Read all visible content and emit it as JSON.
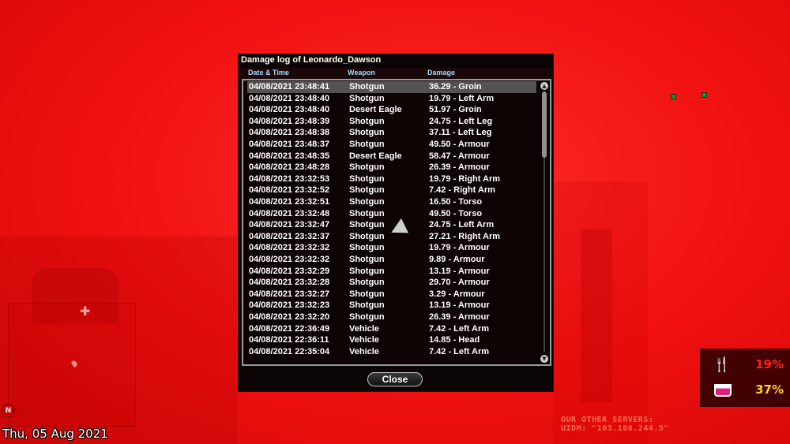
{
  "dialog": {
    "title": "Damage log of Leonardo_Dawson",
    "columns": {
      "date": "Date & Time",
      "weapon": "Weapon",
      "damage": "Damage"
    },
    "rows": [
      {
        "date": "04/08/2021 23:48:41",
        "weapon": "Shotgun",
        "damage": "36.29 - Groin"
      },
      {
        "date": "04/08/2021 23:48:40",
        "weapon": "Shotgun",
        "damage": "19.79 - Left Arm"
      },
      {
        "date": "04/08/2021 23:48:40",
        "weapon": "Desert Eagle",
        "damage": "51.97 - Groin"
      },
      {
        "date": "04/08/2021 23:48:39",
        "weapon": "Shotgun",
        "damage": "24.75 - Left Leg"
      },
      {
        "date": "04/08/2021 23:48:38",
        "weapon": "Shotgun",
        "damage": "37.11 - Left Leg"
      },
      {
        "date": "04/08/2021 23:48:37",
        "weapon": "Shotgun",
        "damage": "49.50 - Armour"
      },
      {
        "date": "04/08/2021 23:48:35",
        "weapon": "Desert Eagle",
        "damage": "58.47 - Armour"
      },
      {
        "date": "04/08/2021 23:48:28",
        "weapon": "Shotgun",
        "damage": "26.39 - Armour"
      },
      {
        "date": "04/08/2021 23:32:53",
        "weapon": "Shotgun",
        "damage": "19.79 - Right Arm"
      },
      {
        "date": "04/08/2021 23:32:52",
        "weapon": "Shotgun",
        "damage": "7.42 - Right Arm"
      },
      {
        "date": "04/08/2021 23:32:51",
        "weapon": "Shotgun",
        "damage": "16.50 - Torso"
      },
      {
        "date": "04/08/2021 23:32:48",
        "weapon": "Shotgun",
        "damage": "49.50 - Torso"
      },
      {
        "date": "04/08/2021 23:32:47",
        "weapon": "Shotgun",
        "damage": "24.75 - Left Arm"
      },
      {
        "date": "04/08/2021 23:32:37",
        "weapon": "Shotgun",
        "damage": "27.21 - Right Arm"
      },
      {
        "date": "04/08/2021 23:32:32",
        "weapon": "Shotgun",
        "damage": "19.79 - Armour"
      },
      {
        "date": "04/08/2021 23:32:32",
        "weapon": "Shotgun",
        "damage": "9.89 - Armour"
      },
      {
        "date": "04/08/2021 23:32:29",
        "weapon": "Shotgun",
        "damage": "13.19 - Armour"
      },
      {
        "date": "04/08/2021 23:32:28",
        "weapon": "Shotgun",
        "damage": "29.70 - Armour"
      },
      {
        "date": "04/08/2021 23:32:27",
        "weapon": "Shotgun",
        "damage": "3.29 - Armour"
      },
      {
        "date": "04/08/2021 23:32:23",
        "weapon": "Shotgun",
        "damage": "13.19 - Armour"
      },
      {
        "date": "04/08/2021 23:32:20",
        "weapon": "Shotgun",
        "damage": "26.39 - Armour"
      },
      {
        "date": "04/08/2021 22:36:49",
        "weapon": "Vehicle",
        "damage": "7.42 - Left Arm"
      },
      {
        "date": "04/08/2021 22:36:11",
        "weapon": "Vehicle",
        "damage": "14.85 - Head"
      },
      {
        "date": "04/08/2021 22:35:04",
        "weapon": "Vehicle",
        "damage": "7.42 - Left Arm"
      }
    ],
    "close_label": "Close"
  },
  "hud": {
    "date_text": "Thu, 05 Aug 2021",
    "compass_label": "N",
    "hunger_value": "19%",
    "thirst_value": "37%",
    "hunger_icon": "fork-knife-icon",
    "thirst_icon": "cup-icon",
    "server_lines": [
      "OUR OTHER SERVERS:",
      "UIDM: \"103.166.244.5\""
    ]
  },
  "colors": {
    "accent_header": "#a9d8ff",
    "hunger": "#ff2020",
    "thirst": "#ffd21a"
  }
}
